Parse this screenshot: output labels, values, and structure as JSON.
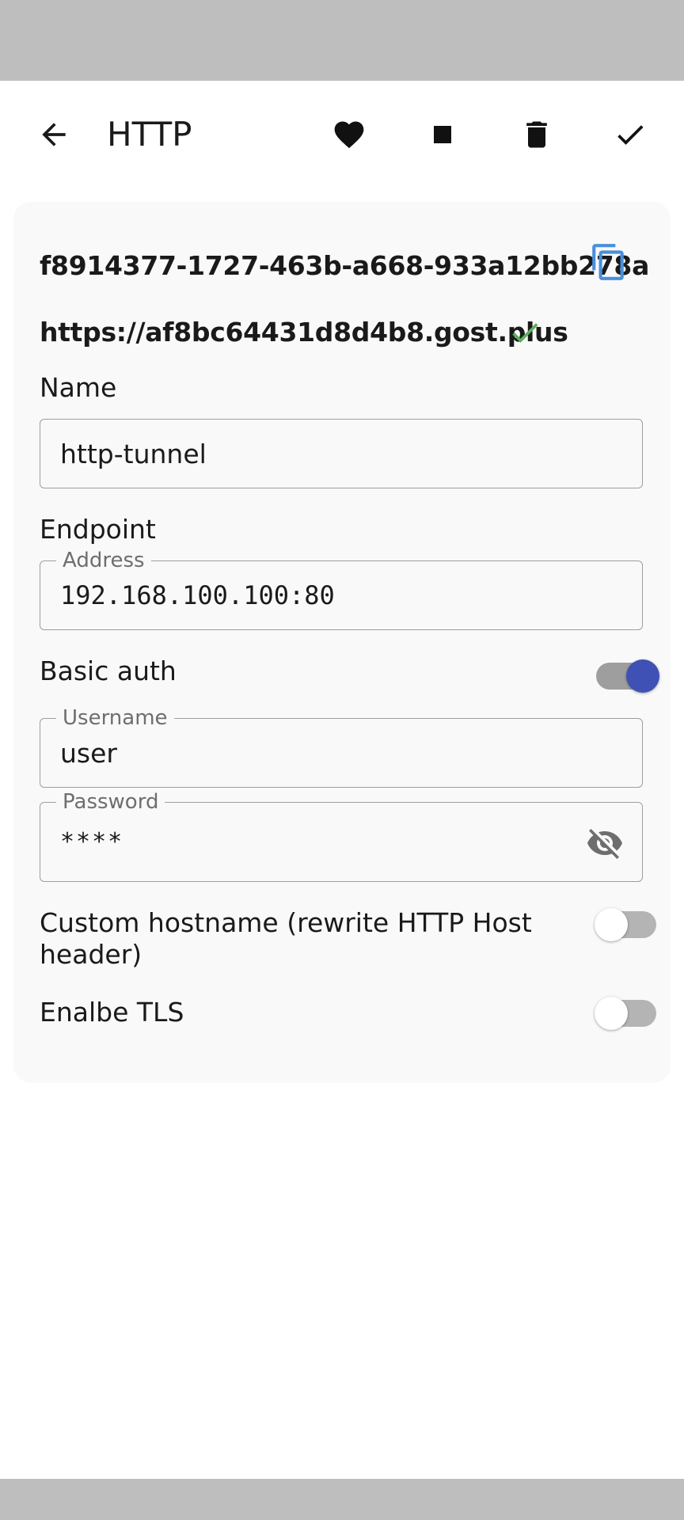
{
  "app_bar": {
    "title": "HTTP",
    "icons": {
      "back": "arrow-left-icon",
      "favorite": "heart-icon",
      "stop": "stop-icon",
      "delete": "trash-icon",
      "save": "check-icon"
    }
  },
  "tunnel": {
    "id": "f8914377-1727-463b-a668-933a12bb278a",
    "url": "https://af8bc64431d8d4b8.gost.plus",
    "url_status_icon": "check-icon",
    "copy_icon": "copy-icon"
  },
  "form": {
    "name_label": "Name",
    "name_value": "http-tunnel",
    "endpoint_label": "Endpoint",
    "address_legend": "Address",
    "address_value": "192.168.100.100:80",
    "basic_auth_label": "Basic auth",
    "basic_auth_enabled": true,
    "username_legend": "Username",
    "username_value": "user",
    "password_legend": "Password",
    "password_value": "****",
    "password_visibility_icon": "eye-off-icon",
    "custom_hostname_label": "Custom hostname (rewrite HTTP Host header)",
    "custom_hostname_enabled": false,
    "tls_label": "Enalbe TLS",
    "tls_enabled": false
  },
  "colors": {
    "accent": "#3f51b5",
    "copy_icon": "#4a8fdc",
    "success": "#5cae5c",
    "system_bars": "#bebebe"
  }
}
